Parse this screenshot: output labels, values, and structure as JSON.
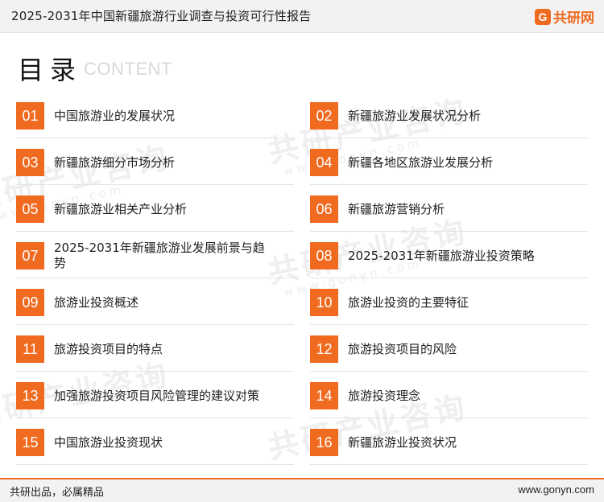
{
  "header": {
    "title": "2025-2031年中国新疆旅游行业调查与投资可行性报告"
  },
  "brand": {
    "logo_char": "G",
    "name": "共研网"
  },
  "toc": {
    "title": "目录",
    "subtitle": "CONTENT"
  },
  "watermark": {
    "text_cn": "共研产业咨询",
    "text_url": "www.gonyn.com"
  },
  "items": [
    {
      "num": "01",
      "label": "中国旅游业的发展状况"
    },
    {
      "num": "02",
      "label": "新疆旅游业发展状况分析"
    },
    {
      "num": "03",
      "label": "新疆旅游细分市场分析"
    },
    {
      "num": "04",
      "label": "新疆各地区旅游业发展分析"
    },
    {
      "num": "05",
      "label": "新疆旅游业相关产业分析"
    },
    {
      "num": "06",
      "label": "新疆旅游营销分析"
    },
    {
      "num": "07",
      "label": "2025-2031年新疆旅游业发展前景与趋势"
    },
    {
      "num": "08",
      "label": "2025-2031年新疆旅游业投资策略"
    },
    {
      "num": "09",
      "label": "旅游业投资概述"
    },
    {
      "num": "10",
      "label": "旅游业投资的主要特征"
    },
    {
      "num": "11",
      "label": "旅游投资项目的特点"
    },
    {
      "num": "12",
      "label": "旅游投资项目的风险"
    },
    {
      "num": "13",
      "label": "加强旅游投资项目风险管理的建议对策"
    },
    {
      "num": "14",
      "label": "旅游投资理念"
    },
    {
      "num": "15",
      "label": "中国旅游业投资现状"
    },
    {
      "num": "16",
      "label": "新疆旅游业投资状况"
    }
  ],
  "footer": {
    "left": "共研出品，必属精品",
    "right": "www.gonyn.com"
  },
  "colors": {
    "accent": "#f06a1f",
    "header_bg": "#f2f2f2"
  }
}
